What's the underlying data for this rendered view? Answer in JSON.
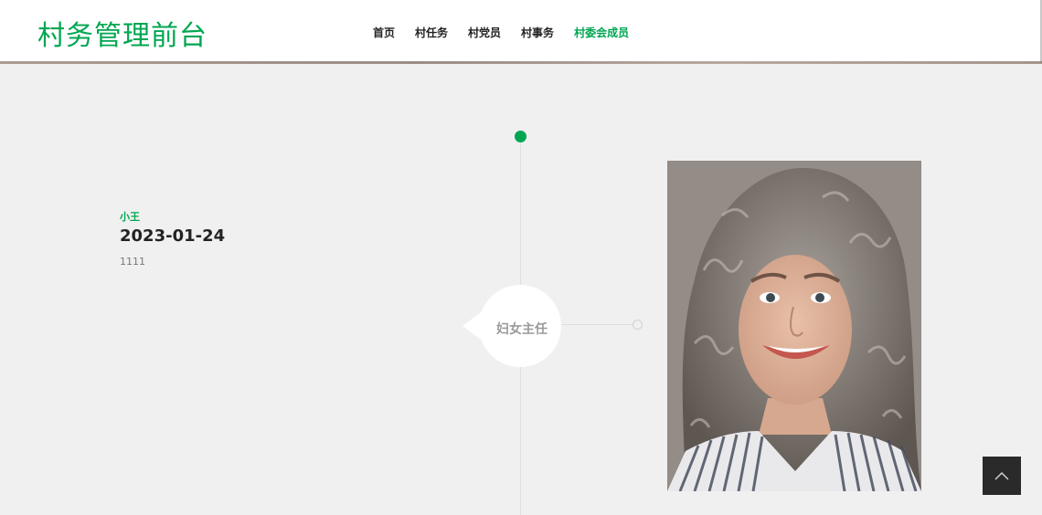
{
  "header": {
    "logo": "村务管理前台",
    "nav": [
      {
        "label": "首页",
        "active": false
      },
      {
        "label": "村任务",
        "active": false
      },
      {
        "label": "村党员",
        "active": false
      },
      {
        "label": "村事务",
        "active": false
      },
      {
        "label": "村委会成员",
        "active": true
      }
    ]
  },
  "timeline": {
    "entry": {
      "name": "小王",
      "date": "2023-01-24",
      "description": "1111",
      "role": "妇女主任"
    }
  },
  "icons": {
    "back_to_top": "chevron-up-icon",
    "member_photo": "portrait-photo"
  },
  "colors": {
    "accent": "#00a651",
    "background": "#f0f0f0",
    "back_to_top_bg": "#2a2a2a"
  }
}
